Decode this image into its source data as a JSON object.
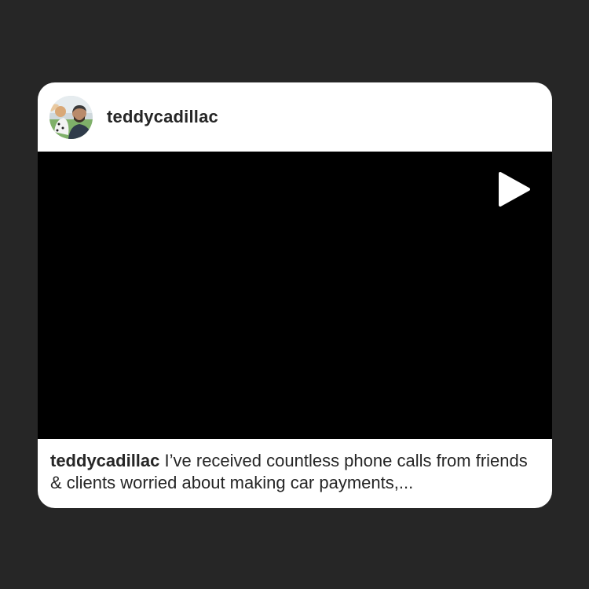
{
  "post": {
    "username": "teddycadillac",
    "avatar_icon": "profile-photo",
    "media": {
      "type": "video",
      "play_icon": "play-icon",
      "background": "#000000"
    },
    "caption": {
      "username": "teddycadillac",
      "text": "I’ve received countless phone calls from friends & clients worried about making car payments,..."
    }
  },
  "colors": {
    "page_background": "#262626",
    "card_background": "#ffffff",
    "text": "#262626"
  }
}
